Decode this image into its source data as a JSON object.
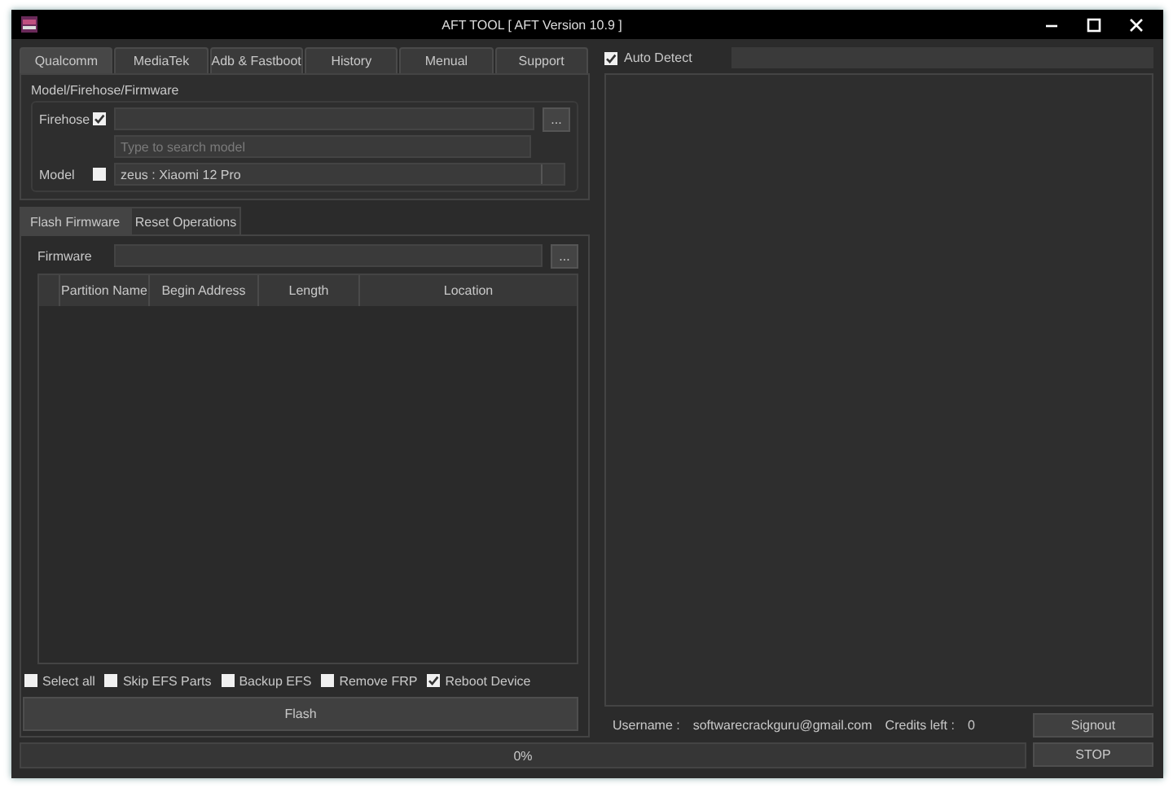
{
  "window": {
    "title": "AFT TOOL  [ AFT Version 10.9 ]"
  },
  "tabs": [
    {
      "label": "Qualcomm",
      "selected": true
    },
    {
      "label": "MediaTek",
      "selected": false
    },
    {
      "label": "Adb & Fastboot",
      "selected": false
    },
    {
      "label": "History",
      "selected": false
    },
    {
      "label": "Menual",
      "selected": false
    },
    {
      "label": "Support",
      "selected": false
    }
  ],
  "model_group": {
    "title": "Model/Firehose/Firmware",
    "firehose": {
      "label": "Firehose",
      "checked": true,
      "browse": "..."
    },
    "search": {
      "placeholder": "Type to search model"
    },
    "model": {
      "label": "Model",
      "checked": false,
      "value": "zeus : Xiaomi 12 Pro"
    }
  },
  "sub_tabs": [
    {
      "label": "Flash Firmware",
      "selected": true
    },
    {
      "label": "Reset Operations",
      "selected": false
    }
  ],
  "firmware": {
    "label": "Firmware",
    "browse": "..."
  },
  "table": {
    "columns": [
      "Partition Name",
      "Begin Address",
      "Length",
      "Location"
    ]
  },
  "options": [
    {
      "label": "Select all",
      "checked": false
    },
    {
      "label": "Skip EFS Parts",
      "checked": false
    },
    {
      "label": "Backup EFS",
      "checked": false
    },
    {
      "label": "Remove FRP",
      "checked": false
    },
    {
      "label": "Reboot Device",
      "checked": true
    }
  ],
  "flash_button": "Flash",
  "auto_detect": {
    "label": "Auto Detect",
    "checked": true
  },
  "account": {
    "username_label": "Username :",
    "username": "softwarecrackguru@gmail.com",
    "credits_label": "Credits left :",
    "credits": "0"
  },
  "signout_button": "Signout",
  "stop_button": "STOP",
  "progress": {
    "level": 0,
    "reading": "0%"
  }
}
